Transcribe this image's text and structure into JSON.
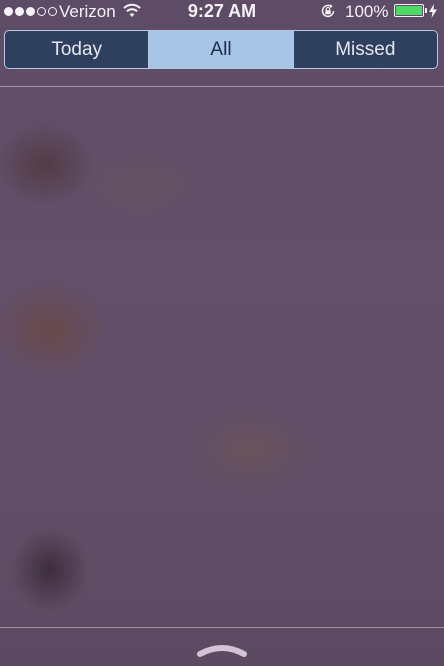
{
  "status_bar": {
    "carrier": "Verizon",
    "time": "9:27 AM",
    "battery_percent": "100%",
    "signal_bars_filled": 3,
    "signal_bars_total": 5,
    "battery_level": 1.0,
    "battery_color": "#4cd964",
    "icons": [
      "wifi-icon",
      "rotation-lock-icon",
      "battery-icon",
      "charging-bolt-icon"
    ]
  },
  "tabs": [
    {
      "label": "Today",
      "selected": false
    },
    {
      "label": "All",
      "selected": true
    },
    {
      "label": "Missed",
      "selected": false
    }
  ],
  "colors": {
    "background": "#5f4e66",
    "segment_selected": "#a6c4e6",
    "segment_background": "#2f3f5e",
    "segment_border": "#b9c7e2"
  },
  "footer": {
    "grabber_icon": "chevron-up-icon"
  }
}
